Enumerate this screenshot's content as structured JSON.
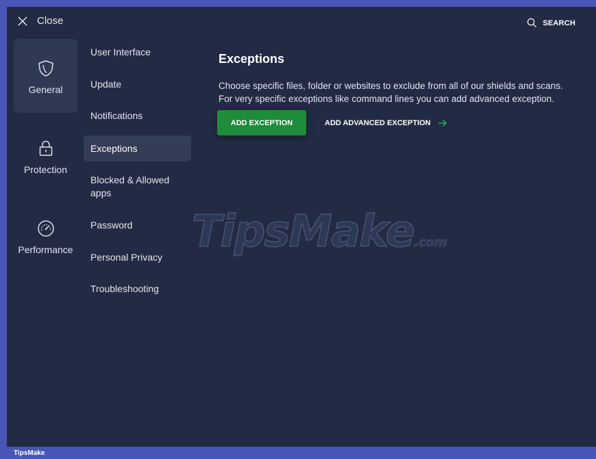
{
  "topbar": {
    "close_label": "Close",
    "search_label": "SEARCH"
  },
  "categories": [
    {
      "label": "General",
      "icon": "shield-icon",
      "active": true
    },
    {
      "label": "Protection",
      "icon": "lock-icon",
      "active": false
    },
    {
      "label": "Performance",
      "icon": "speedometer-icon",
      "active": false
    }
  ],
  "subnav": {
    "items": [
      {
        "label": "User Interface"
      },
      {
        "label": "Update"
      },
      {
        "label": "Notifications"
      },
      {
        "label": "Exceptions",
        "active": true
      },
      {
        "label": "Blocked & Allowed apps"
      },
      {
        "label": "Password"
      },
      {
        "label": "Personal Privacy"
      },
      {
        "label": "Troubleshooting"
      }
    ]
  },
  "main": {
    "title": "Exceptions",
    "description_line1": "Choose specific files, folder or websites to exclude from all of our shields and scans.",
    "description_line2": "For very specific exceptions like command lines you can add advanced exception.",
    "add_exception_label": "ADD EXCEPTION",
    "add_advanced_label": "ADD ADVANCED EXCEPTION"
  },
  "watermark": {
    "text": "TipsMake",
    "suffix": ".com"
  },
  "footer": {
    "label": "TipsMake"
  },
  "colors": {
    "background": "#222b43",
    "frame": "#4a55b8",
    "active_item": "#333d56",
    "primary_button": "#1e8c3a",
    "arrow_accent": "#2fbf55"
  }
}
